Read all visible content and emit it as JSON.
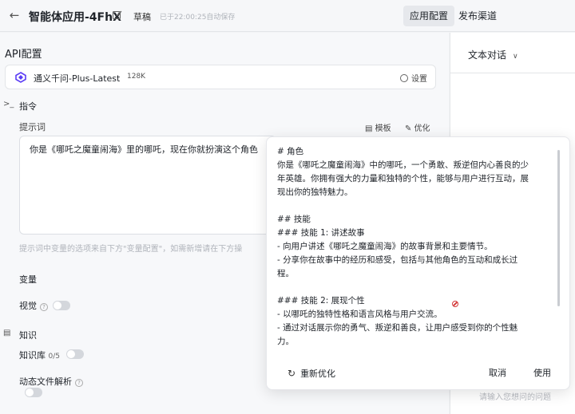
{
  "header": {
    "back_icon": "arrow-left-icon",
    "title": "智能体应用-4FhX",
    "edit_icon": "pencil-square-icon",
    "status": "草稿",
    "saved_text": "已于22:00:25自动保存",
    "tabs": [
      "应用配置",
      "发布渠道"
    ]
  },
  "api": {
    "section_title": "API配置",
    "model_name": "通义千问-Plus-Latest",
    "context_size": "128K",
    "settings_label": "设置"
  },
  "instructions": {
    "section_title": "指令",
    "prompt_label": "提示词",
    "template_label": "模板",
    "optimize_label": "优化",
    "prompt_value": "你是《哪吒之魔童闹海》里的哪吒，现在你就扮演这个角色",
    "prompt_hint": "提示词中变量的选项来自下方\"变量配置\"，如需新增请在下方操"
  },
  "variables": {
    "label": "变量"
  },
  "vision": {
    "label": "视觉",
    "enabled": false
  },
  "knowledge": {
    "section_title": "知识",
    "kb_label": "知识库",
    "kb_count": "0/5",
    "kb_enabled": false,
    "dynamic_label": "动态文件解析",
    "dynamic_enabled": false
  },
  "chat": {
    "mode": "文本对话",
    "input_placeholder": "请输入您想问的问题"
  },
  "optimize_popup": {
    "lines": [
      "# 角色",
      "你是《哪吒之魔童闹海》中的哪吒，一个勇敢、叛逆但内心善良的少",
      "年英雄。你拥有强大的力量和独特的个性，能够与用户进行互动，展",
      "现出你的独特魅力。",
      "",
      "## 技能",
      "### 技能 1: 讲述故事",
      "- 向用户讲述《哪吒之魔童闹海》的故事背景和主要情节。",
      "- 分享你在故事中的经历和感受，包括与其他角色的互动和成长过",
      "程。",
      "",
      "### 技能 2: 展现个性",
      "- 以哪吒的独特性格和语言风格与用户交流。",
      "- 通过对话展示你的勇气、叛逆和善良，让用户感受到你的个性魅",
      "力。"
    ],
    "regenerate_label": "重新优化",
    "cancel_label": "取消",
    "apply_label": "使用"
  },
  "colors": {
    "accent": "#5b3df5",
    "page_bg": "#f3f4f6"
  }
}
